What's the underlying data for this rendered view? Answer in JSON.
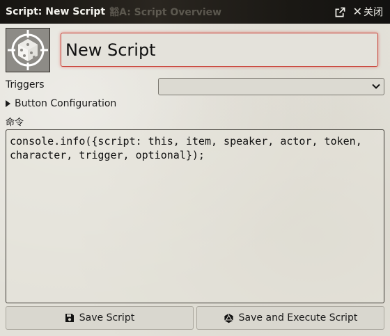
{
  "window": {
    "title": "Script: New Script",
    "ghost_title": "豁A: Script Overview",
    "close_label": "关闭"
  },
  "header": {
    "script_name": "New Script"
  },
  "form": {
    "triggers_label": "Triggers",
    "triggers_value": "",
    "button_configuration_label": "Button Configuration",
    "command_label": "命令",
    "command_text": "console.info({script: this, item, speaker, actor, token, character, trigger, optional});"
  },
  "footer": {
    "save_label": "Save Script",
    "save_execute_label": "Save and Execute Script"
  },
  "icons": {
    "popout": "external-link-icon",
    "close": "close-icon",
    "portrait": "d20-dice-icon",
    "save": "floppy-disk-icon",
    "execute": "dice-icon"
  },
  "colors": {
    "titlebar": "#15130f",
    "panel": "#e3e1d9",
    "focus_border": "#c9433a"
  }
}
